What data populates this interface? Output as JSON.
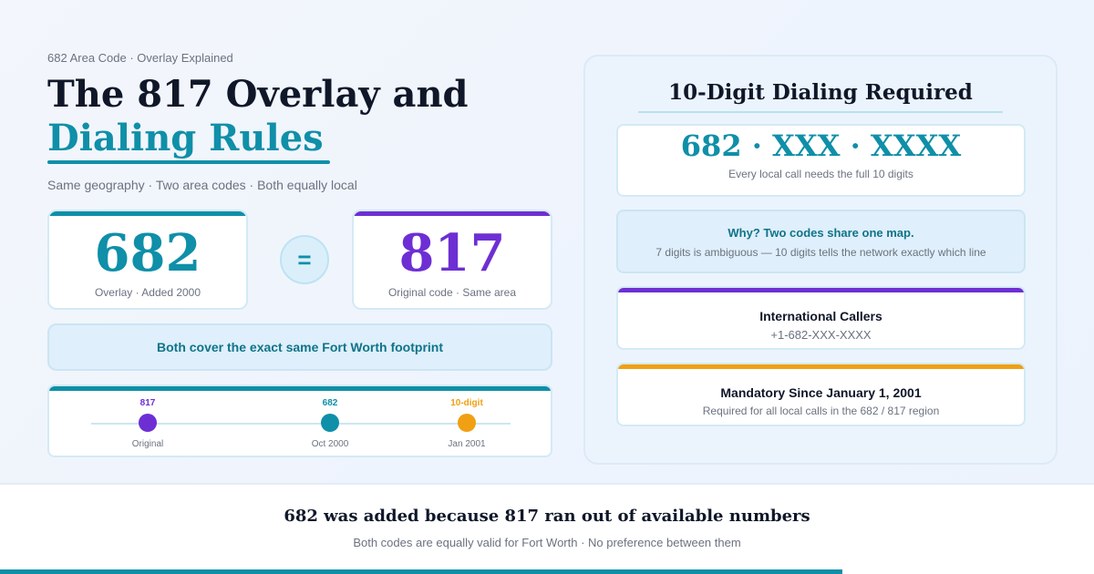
{
  "header": {
    "eyebrow": "682 Area Code · Overlay Explained",
    "title_line1": "The 817 Overlay and",
    "title_line2": "Dialing Rules",
    "subtitle": "Same geography · Two area codes · Both equally local"
  },
  "codes": {
    "overlay": {
      "number": "682",
      "caption": "Overlay · Added 2000",
      "color": "#0f8fa8"
    },
    "original": {
      "number": "817",
      "caption": "Original code · Same area",
      "color": "#6d2fd3"
    },
    "equals_symbol": "="
  },
  "footprint_note": "Both cover the exact same Fort Worth footprint",
  "timeline": {
    "points": [
      {
        "label": "817",
        "sub": "Original",
        "color": "#6d2fd3"
      },
      {
        "label": "682",
        "sub": "Oct 2000",
        "color": "#0f8fa8"
      },
      {
        "label": "10-digit",
        "sub": "Jan 2001",
        "color": "#f0a012"
      }
    ]
  },
  "right_panel": {
    "title": "10-Digit Dialing Required",
    "format": "682 · XXX · XXXX",
    "format_note": "Every local call needs the full 10 digits",
    "why": {
      "heading": "Why? Two codes share one map.",
      "text": "7 digits is ambiguous — 10 digits tells the network exactly which line"
    },
    "international": {
      "heading": "International Callers",
      "text": "+1-682-XXX-XXXX",
      "accent": "#6d2fd3"
    },
    "mandatory": {
      "heading": "Mandatory Since January 1, 2001",
      "text": "Required for all local calls in the 682 / 817 region",
      "accent": "#f0a012"
    }
  },
  "footer": {
    "heading": "682 was added because 817 ran out of available numbers",
    "text": "Both codes are equally valid for Fort Worth · No preference between them"
  },
  "progress": {
    "fraction": 0.77,
    "color": "#0f8fa8"
  }
}
